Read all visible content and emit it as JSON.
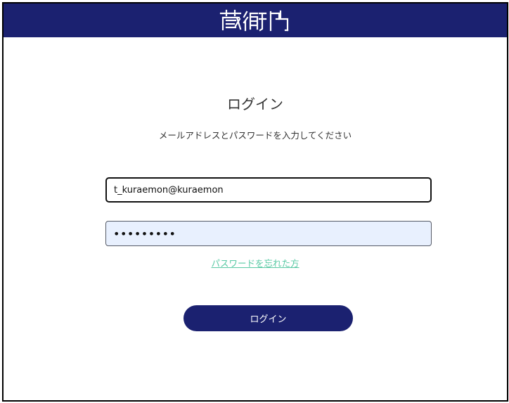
{
  "header": {
    "logo_text": "蔵衛門",
    "brand_color": "#1b2170"
  },
  "login": {
    "title": "ログイン",
    "subtitle": "メールアドレスとパスワードを入力してください",
    "email_value": "t_kuraemon@kuraemon",
    "password_value": "•••••••••",
    "forgot_link": "パスワードを忘れた方",
    "submit_label": "ログイン",
    "link_color": "#58c9a4",
    "password_autofill_bg": "#e8f0fe"
  }
}
